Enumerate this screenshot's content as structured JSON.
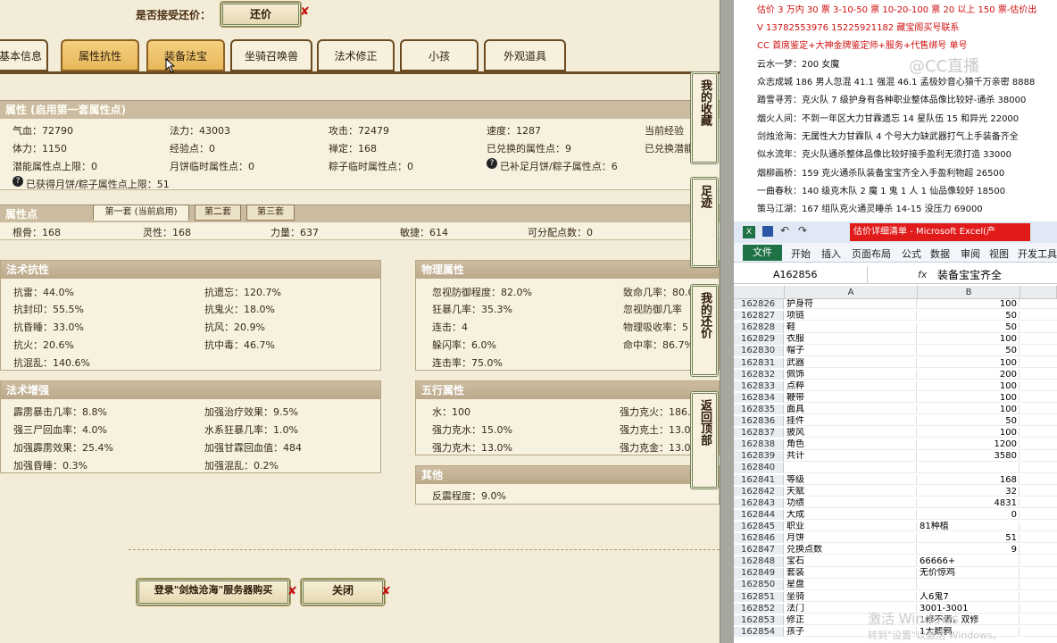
{
  "game": {
    "accept_label": "是否接受还价：",
    "counter_offer_btn": "还价",
    "tabs": [
      "基本信息",
      "属性抗性",
      "装备法宝",
      "坐骑召唤兽",
      "法术修正",
      "小孩",
      "外观道具"
    ],
    "attr_section_title": "属性 (启用第一套属性点)",
    "attr_rows": [
      [
        "气血：72790",
        "法力：43003",
        "攻击：72479",
        "速度：1287",
        "当前经验"
      ],
      [
        "体力：1150",
        "经验点：0",
        "禅定：168",
        "已兑换的属性点：9",
        "已兑换潜能"
      ],
      [
        "潜能属性点上限：0",
        "月饼临时属性点：0",
        "粽子临时属性点：0",
        "已补足月饼/粽子属性点：6",
        ""
      ]
    ],
    "attr_extra": "已获得月饼/粽子属性点上限：51",
    "points_section_title": "属性点",
    "point_tabs": [
      "第一套 (当前启用)",
      "第二套",
      "第三套"
    ],
    "points_row": [
      "根骨：168",
      "灵性：168",
      "力量：637",
      "敏捷：614",
      "可分配点数：0"
    ],
    "resist_title": "法术抗性",
    "resist": [
      [
        "抗雷：44.0%",
        "抗遗忘：120.7%"
      ],
      [
        "抗封印：55.5%",
        "抗鬼火：18.0%"
      ],
      [
        "抗昏睡：33.0%",
        "抗风：20.9%"
      ],
      [
        "抗火：20.6%",
        "抗中毒：46.7%"
      ],
      [
        "抗混乱：140.6%",
        ""
      ]
    ],
    "physical_title": "物理属性",
    "physical": [
      [
        "忽视防御程度：82.0%",
        "致命几率：80.0"
      ],
      [
        "狂暴几率：35.3%",
        "忽视防御几率"
      ],
      [
        "连击：4",
        "物理吸收率：5"
      ],
      [
        "躲闪率：6.0%",
        "命中率：86.7%"
      ],
      [
        "连击率：75.0%",
        ""
      ]
    ],
    "enhance_title": "法术增强",
    "enhance": [
      [
        "霹雳暴击几率：8.8%",
        "加强治疗效果：9.5%"
      ],
      [
        "强三尸回血率：4.0%",
        "水系狂暴几率：1.0%"
      ],
      [
        "加强霹雳效果：25.4%",
        "加强甘霖回血值：484"
      ],
      [
        "加强昏睡：0.3%",
        "加强混乱：0.2%"
      ]
    ],
    "five_title": "五行属性",
    "five": [
      [
        "水：100",
        "强力克火：186."
      ],
      [
        "强力克水：15.0%",
        "强力克土：13.0"
      ],
      [
        "强力克木：13.0%",
        "强力克金：13.0"
      ]
    ],
    "other_title": "其他",
    "other": "反震程度：9.0%",
    "side_buttons": [
      "我的收藏",
      "足迹",
      "我的还价",
      "返回顶部"
    ],
    "login_btn": "登录\"剑烛沧海\"服务器购买",
    "close_btn": "关闭"
  },
  "notes": {
    "lines": [
      {
        "text": "估价 3 万内 30 票 3-10-50 票 10-20-100 票 20 以上 150 票-估价出",
        "color": "red"
      },
      {
        "text": "V 13782553976   15225921182   藏宝阁买号联系",
        "color": "red"
      },
      {
        "text": "CC 首席鉴定+大神金牌鉴定师+服务+代售绑号 单号",
        "color": "red"
      },
      {
        "text": "云水一梦：200 女魔",
        "color": "black"
      },
      {
        "text": "众志成城 186 男人忽混 41.1 强混 46.1 孟极妙音心猿千万亲密 8888",
        "color": "black"
      },
      {
        "text": "踏雪寻芳：克火队 7 级护身有各种职业整体品像比较好-通杀 38000",
        "color": "black"
      },
      {
        "text": "烟火人间：不到一年区大力甘霖遗忘 14 星队伍 15 和异光 22000",
        "color": "black"
      },
      {
        "text": "剑烛沧海：无属性大力甘霖队 4 个号大力缺武器打气上手装备齐全",
        "color": "black"
      },
      {
        "text": "似水流年：克火队通杀整体品像比较好接手盈利无须打造 33000",
        "color": "black"
      },
      {
        "text": "烟柳画桥：159 克火通杀队装备宝宝齐全入手盈利物超 26500",
        "color": "black"
      },
      {
        "text": "一曲春秋：140 级克木队 2 魔 1 鬼 1 人 1 仙品像较好 18500",
        "color": "black"
      },
      {
        "text": "策马江湖：167 组队克火通灵睡杀 14-15 没压力 69000",
        "color": "black"
      }
    ],
    "watermark": "@CC直播"
  },
  "excel": {
    "title": "估价详细清单 - Microsoft Excel(产",
    "file_tab": "文件",
    "menus": [
      "开始",
      "插入",
      "页面布局",
      "公式",
      "数据",
      "审阅",
      "视图",
      "开发工具"
    ],
    "name_box": "A162856",
    "fx": "fx",
    "formula": "装备宝宝齐全",
    "col_a": "A",
    "col_b": "B",
    "rows": [
      [
        "162826",
        "护身符",
        "100"
      ],
      [
        "162827",
        "项链",
        "50"
      ],
      [
        "162828",
        "鞋",
        "50"
      ],
      [
        "162829",
        "衣服",
        "100"
      ],
      [
        "162830",
        "帽子",
        "50"
      ],
      [
        "162831",
        "武器",
        "100"
      ],
      [
        "162832",
        "佩饰",
        "200"
      ],
      [
        "162833",
        "点粹",
        "100"
      ],
      [
        "162834",
        "鞭带",
        "100"
      ],
      [
        "162835",
        "面具",
        "100"
      ],
      [
        "162836",
        "挂件",
        "50"
      ],
      [
        "162837",
        "披风",
        "100"
      ],
      [
        "162838",
        "角色",
        "1200"
      ],
      [
        "162839",
        "共计",
        "3580"
      ],
      [
        "162840",
        "",
        ""
      ],
      [
        "162841",
        "等级",
        "168"
      ],
      [
        "162842",
        "天赋",
        "32"
      ],
      [
        "162843",
        "功绩",
        "4831"
      ],
      [
        "162844",
        "大成",
        "0"
      ],
      [
        "162845",
        "职业",
        "81种植"
      ],
      [
        "162846",
        "月饼",
        "51"
      ],
      [
        "162847",
        "兑换点数",
        "9"
      ],
      [
        "162848",
        "宝石",
        "66666+"
      ],
      [
        "162849",
        "套装",
        "无价惊鸡"
      ],
      [
        "162850",
        "星盘",
        ""
      ],
      [
        "162851",
        "坐骑",
        "人6鬼7"
      ],
      [
        "162852",
        "法门",
        "3001-3001"
      ],
      [
        "162853",
        "修正",
        "1修不满，双修"
      ],
      [
        "162854",
        "孩子",
        "1大鹅鸦"
      ]
    ],
    "watermark1": "激活 Windows",
    "watermark2": "转到\"设置\"以激活 Windows。"
  }
}
